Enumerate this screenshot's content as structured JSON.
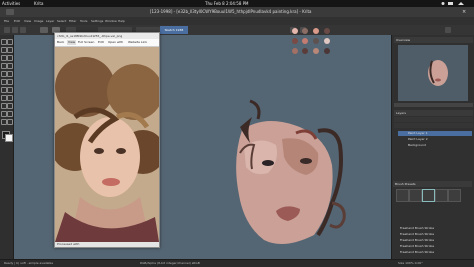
{
  "os": {
    "activities": "Activities",
    "app": "Krita",
    "time": "Thu Feb 8   2:04:58 PM"
  },
  "window": {
    "title": "[123-1998] - [e32b_ll3tyl0CWY9Bouul1W5_hthpjdlPnudlavk4 painting.kra] - Krita",
    "tab": "Sketch 1938"
  },
  "menu": [
    "File",
    "Edit",
    "View",
    "Image",
    "Layer",
    "Select",
    "Filter",
    "Tools",
    "Settings",
    "Window",
    "Help"
  ],
  "reference": {
    "title": "c3db_l1_ss1tBI9b20uu1W55_-Rhpe.vel_png",
    "buttons": [
      "Back",
      "View",
      "Full Screen",
      "Edit",
      "Open with",
      "Website Link"
    ],
    "status": "Processed with"
  },
  "palette_colors": [
    "#e5b6ab",
    "#8c6d66",
    "#d99a8a",
    "#6a4a46",
    "#7a4a44",
    "#c47c72",
    "#5e5250",
    "#e0c6c0",
    "#a27064",
    "#5a3d3a",
    "#b98778",
    "#4a3636"
  ],
  "docker": {
    "overview_label": "Overview",
    "layers_title": "Layers",
    "layers": [
      "Paint Layer 1",
      "Paint Layer 2",
      "Background"
    ],
    "brush_presets_title": "Brush Presets",
    "presets_list": [
      "Freehand Brush Stroke",
      "Freehand Brush Stroke",
      "Freehand Brush Stroke",
      "Freehand Brush Stroke",
      "Freehand Brush Stroke"
    ]
  },
  "status": {
    "left": "Ready | b) soft ..simple available",
    "center": "RGB/Alpha (8-bit integer/channel) sRGB",
    "right": "Size 100%  0.00°"
  }
}
